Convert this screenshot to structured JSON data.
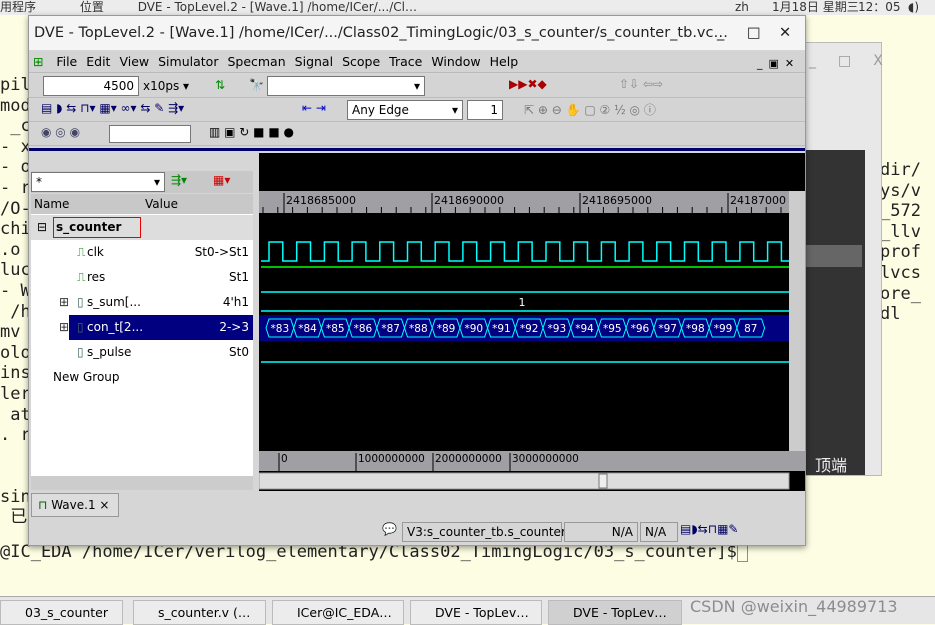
{
  "topbar": {
    "apps": "用程序",
    "places": "位置",
    "window": "DVE - TopLevel.2 - [Wave.1]  /home/ICer/.../Cl…",
    "lang": "zh",
    "date": "1月18日 星期三",
    "time": "12：05"
  },
  "terminal": {
    "lines": [
      "pil",
      "mod",
      " _c",
      "- x",
      "- o",
      "- rp",
      "/O-",
      "chi",
      ".o",
      "luc",
      "- Wl",
      " /h",
      "mv",
      "olo",
      "ins",
      "ler",
      " at",
      ". ru",
      "",
      "",
      "sin",
      " 已"
    ],
    "right_lines": [
      "dir/",
      "ys/v",
      "_572",
      "_llv",
      "prof",
      "lvcs",
      "ore_",
      "dl"
    ],
    "prompt": "@IC_EDA /home/ICer/verilog_elementary/Class02_TimingLogic/03_s_counter]$"
  },
  "bg_window": {
    "label": "顶端"
  },
  "dve": {
    "title": "DVE - TopLevel.2 - [Wave.1]  /home/ICer/.../Class02_TimingLogic/03_s_counter/s_counter_tb.vc…",
    "menu": [
      "File",
      "Edit",
      "View",
      "Simulator",
      "Specman",
      "Signal",
      "Scope",
      "Trace",
      "Window",
      "Help"
    ],
    "time_value": "4500",
    "time_unit": "x10ps ▾",
    "edge_select": "Any Edge",
    "edge_count": "1",
    "filter": "*",
    "columns": {
      "name": "Name",
      "value": "Value"
    },
    "scope": "s_counter",
    "signals": [
      {
        "name": "clk",
        "value": "St0->St1"
      },
      {
        "name": "res",
        "value": "St1"
      },
      {
        "name": "s_sum[...",
        "value": "4'h1"
      },
      {
        "name": "con_t[2...",
        "value": "2->3"
      },
      {
        "name": "s_pulse",
        "value": "St0"
      }
    ],
    "group": "New Group",
    "ruler": [
      "2418685000",
      "2418690000",
      "2418695000",
      "24187000"
    ],
    "sum_value": "1",
    "bus": [
      "*83",
      "*84",
      "*85",
      "*86",
      "*87",
      "*88",
      "*89",
      "*90",
      "*91",
      "*92",
      "*93",
      "*94",
      "*95",
      "*96",
      "*97",
      "*98",
      "*99",
      "87"
    ],
    "overview_ruler": [
      "0",
      "1000000000",
      "2000000000",
      "3000000000"
    ],
    "tab": "Wave.1",
    "status": {
      "scope": "V3:s_counter_tb.s_counter",
      "na1": "N/A",
      "na2": "N/A"
    },
    "colors": {
      "clk_high": "#00ff00",
      "low": "#00ffff",
      "bus_fill": "#000080",
      "selected": "#000080"
    }
  },
  "taskbar": [
    {
      "label": "03_s_counter"
    },
    {
      "label": "s_counter.v (…"
    },
    {
      "label": "ICer@IC_EDA…"
    },
    {
      "label": "DVE - TopLev…"
    },
    {
      "label": "DVE - TopLev…"
    }
  ],
  "watermark": "CSDN @weixin_44989713"
}
